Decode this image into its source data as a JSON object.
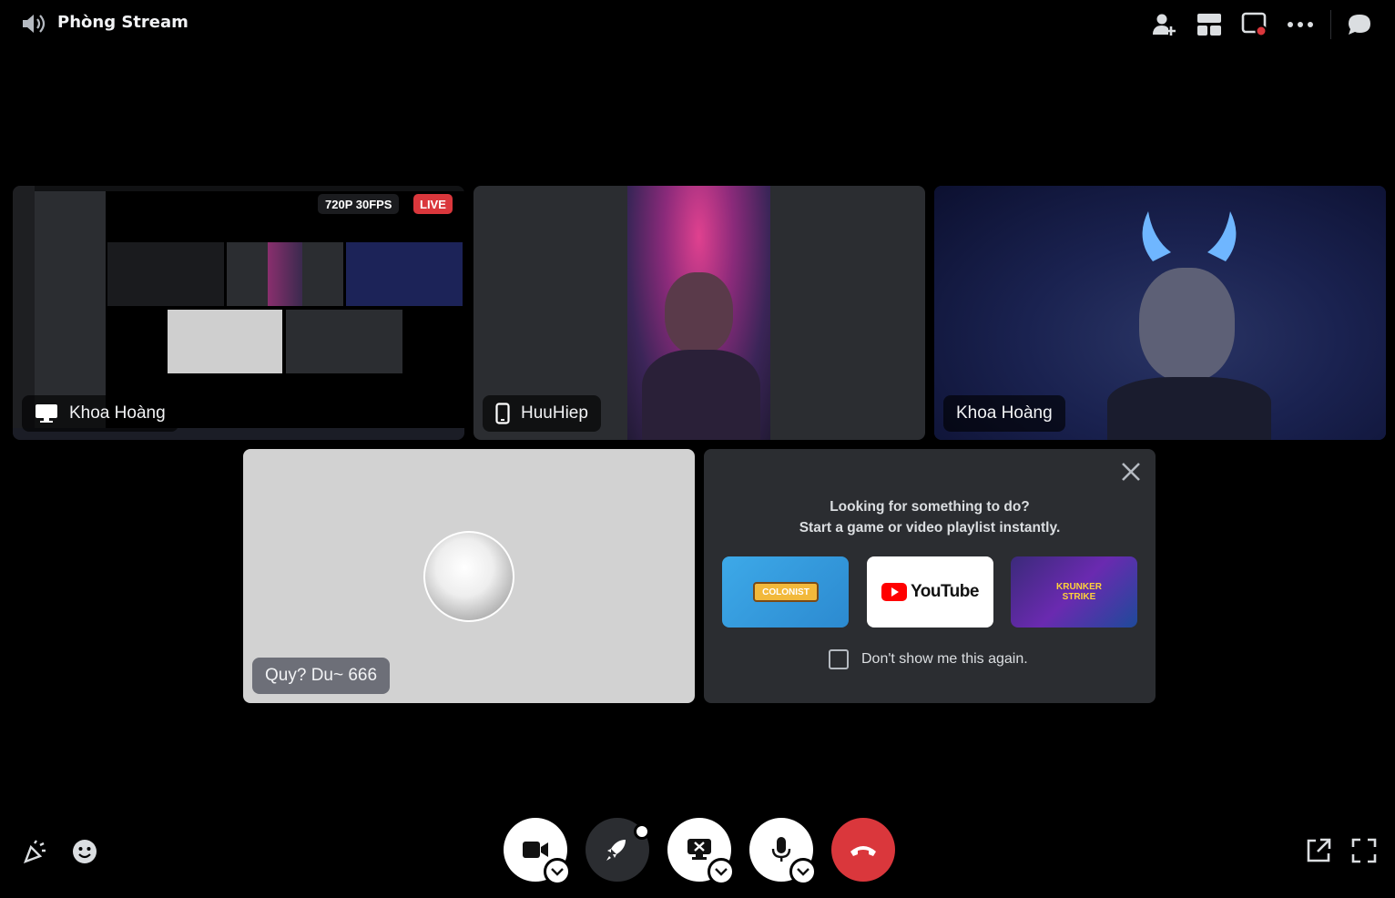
{
  "header": {
    "room_name": "Phòng Stream",
    "icons": [
      "speaker-icon",
      "add-member-icon",
      "layout-grid-icon",
      "screen-record-icon",
      "more-options-icon",
      "chat-bubble-icon"
    ]
  },
  "tiles": {
    "stream": {
      "name": "Khoa Hoàng",
      "quality_badge": "720P 30FPS",
      "live_badge": "LIVE",
      "device": "screen-icon"
    },
    "huuhiep": {
      "name": "HuuHiep",
      "device": "phone-icon"
    },
    "khoa_cam": {
      "name": "Khoa Hoàng"
    },
    "quy": {
      "name": "Quy? Du~ 666"
    }
  },
  "activity_panel": {
    "line1": "Looking for something to do?",
    "line2": "Start a game or video playlist instantly.",
    "cards": [
      "COLONIST",
      "YouTube",
      "KRUNKER STRIKE"
    ],
    "dont_show": "Don't show me this again."
  },
  "controls": {
    "buttons": [
      "camera-button",
      "activity-rocket-button",
      "screen-share-button",
      "microphone-button",
      "disconnect-button"
    ]
  },
  "colors": {
    "background": "#000000",
    "tile_dark": "#2b2d31",
    "danger": "#da373c",
    "white": "#ffffff"
  }
}
